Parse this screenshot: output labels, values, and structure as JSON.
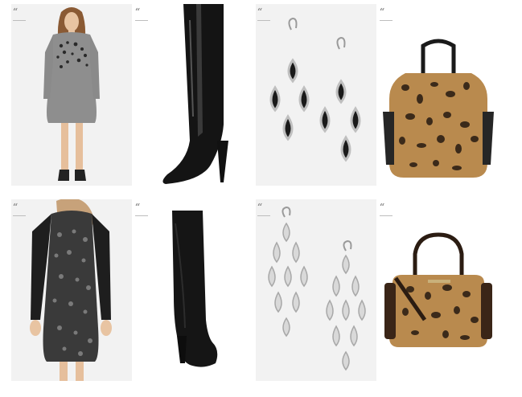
{
  "gallery": {
    "quote_mark": "“",
    "items": [
      {
        "icon": "gray-sweater-dress-product-icon"
      },
      {
        "icon": "black-patent-knee-boot-product-icon"
      },
      {
        "icon": "black-teardrop-chandelier-earrings-product-icon"
      },
      {
        "icon": "leopard-print-tote-bag-product-icon"
      },
      {
        "icon": "leopard-sequin-sweater-dress-product-icon"
      },
      {
        "icon": "black-suede-over-knee-boot-product-icon"
      },
      {
        "icon": "silver-petal-chandelier-earrings-product-icon"
      },
      {
        "icon": "leopard-print-satchel-bag-product-icon"
      }
    ]
  },
  "colors": {
    "tile_background": "#f2f2f2",
    "quote_mark": "#8a8a8a",
    "leopard_base": "#b98a4e",
    "leopard_spot": "#3b2a1a"
  }
}
